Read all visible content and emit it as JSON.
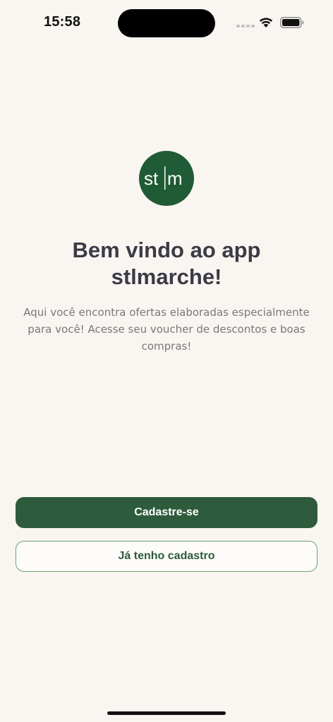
{
  "status_bar": {
    "time": "15:58"
  },
  "logo": {
    "text": "st|m",
    "color": "#1f5b34"
  },
  "welcome": {
    "title_line1": "Bem vindo ao app",
    "title_line2": "stlmarche!",
    "subtitle_line1": "Aqui você encontra ofertas elaboradas especialmente",
    "subtitle_line2": "para você! Acesse seu voucher de descontos e boas",
    "subtitle_line3": "compras!"
  },
  "actions": {
    "register_label": "Cadastre-se",
    "login_label": "Já tenho cadastro"
  },
  "colors": {
    "background": "#f9f6f2",
    "primary": "#2e5b3b",
    "secondary_border": "#6da078"
  }
}
